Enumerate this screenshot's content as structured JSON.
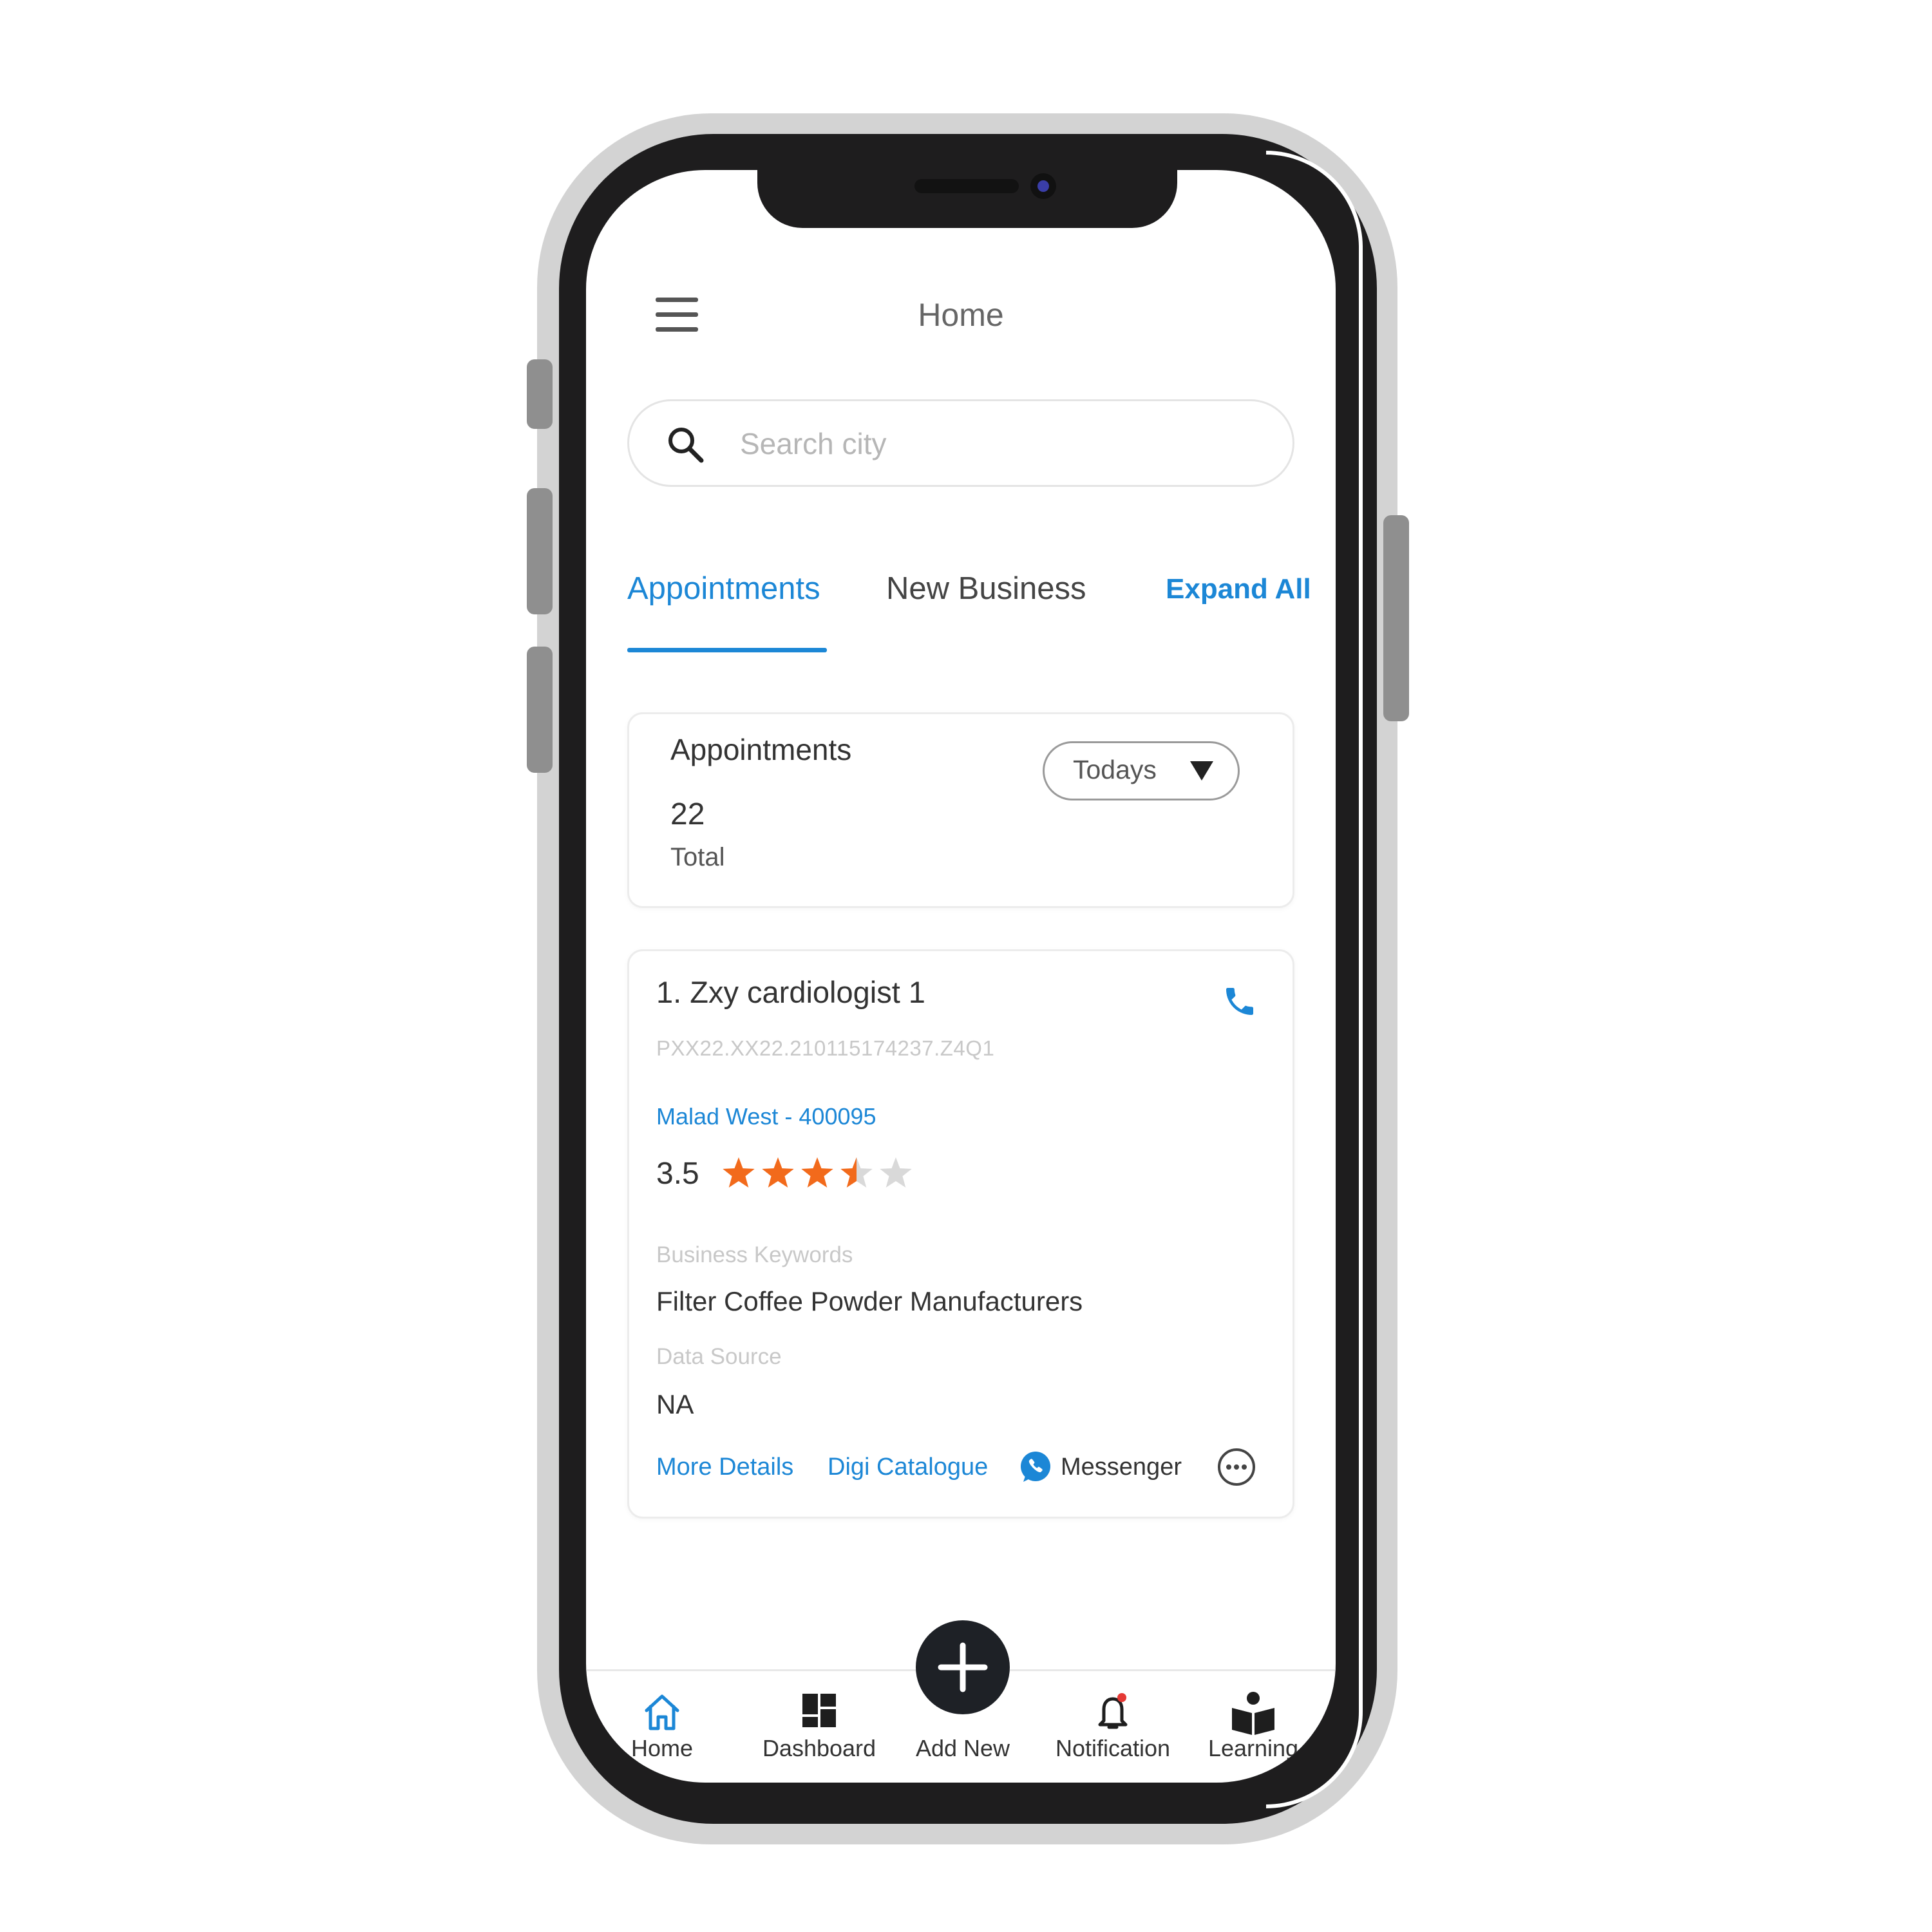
{
  "header": {
    "title": "Home"
  },
  "search": {
    "placeholder": "Search city",
    "value": ""
  },
  "tabs": [
    {
      "label": "Appointments",
      "active": true
    },
    {
      "label": "New Business",
      "active": false
    }
  ],
  "expand_all_label": "Expand All",
  "summary": {
    "heading": "Appointments",
    "count": "22",
    "count_label": "Total",
    "filter": {
      "selected": "Todays"
    }
  },
  "listing": {
    "name": "1. Zxy cardiologist 1",
    "code": "PXX22.XX22.210115174237.Z4Q1",
    "location": "Malad West - 400095",
    "rating": "3.5",
    "rating_max": 5,
    "keywords_label": "Business Keywords",
    "keywords_value": "Filter Coffee Powder Manufacturers",
    "source_label": "Data Source",
    "source_value": "NA",
    "more_details": "More Details",
    "digi_catalogue": "Digi Catalogue",
    "messenger": "Messenger"
  },
  "bottom_nav": [
    {
      "label": "Home",
      "icon": "home-icon",
      "active": true
    },
    {
      "label": "Dashboard",
      "icon": "dashboard-icon"
    },
    {
      "label": "Add New",
      "icon": "plus-icon"
    },
    {
      "label": "Notification",
      "icon": "bell-icon"
    },
    {
      "label": "Learning",
      "icon": "reader-icon"
    }
  ],
  "colors": {
    "accent": "#1c87d6",
    "star": "#f26a1b",
    "star_empty": "#d9d9d9",
    "phone_frame": "#d3d3d3",
    "bezel": "#1e1d1e",
    "fab": "#1e2126"
  }
}
